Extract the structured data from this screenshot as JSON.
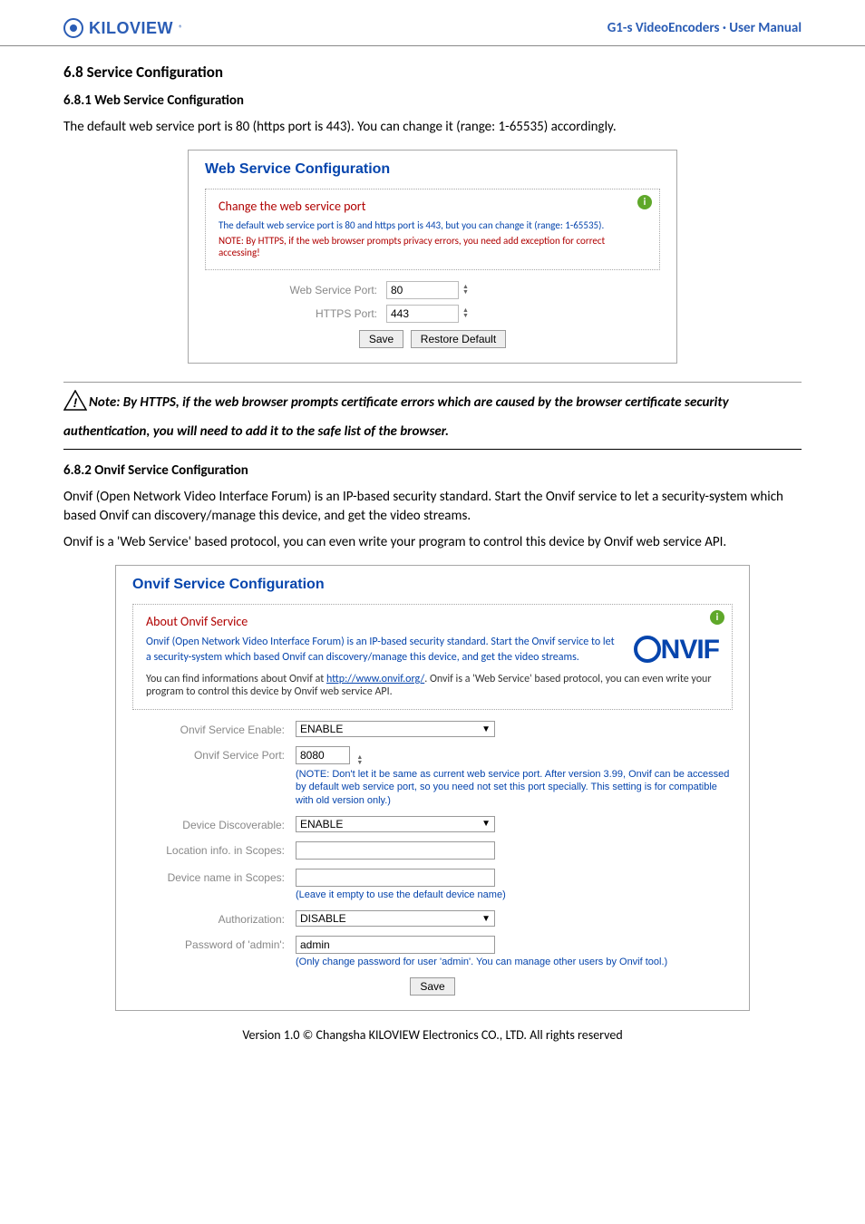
{
  "header": {
    "logo_text": "KILOVIEW",
    "manual_title": "G1-s VideoEncoders · User Manual"
  },
  "section": {
    "heading": "6.8 Service Configuration",
    "sub1": {
      "heading": "6.8.1   Web Service Configuration",
      "intro": "The default web service port is 80 (https port is 443). You can change it (range: 1-65535) accordingly."
    },
    "sub2": {
      "heading": "6.8.2   Onvif Service Configuration",
      "intro1": "Onvif (Open Network Video Interface Forum) is an IP-based security standard. Start the Onvif service to let a security-system which based Onvif can discovery/manage this device, and get the video streams.",
      "intro2": "Onvif is a 'Web Service' based protocol, you can even write your program to control this device by Onvif web service API."
    }
  },
  "web_panel": {
    "title": "Web Service Configuration",
    "box_heading": "Change the web service port",
    "box_line1": "The default web service port is 80 and https port is 443, but you can change it (range: 1-65535).",
    "box_line2": "NOTE: By HTTPS, if the web browser prompts privacy errors, you need add exception for correct accessing!",
    "rows": {
      "web_label": "Web Service Port:",
      "web_value": "80",
      "https_label": "HTTPS Port:",
      "https_value": "443"
    },
    "buttons": {
      "save": "Save",
      "restore": "Restore Default"
    }
  },
  "note": "Note: By HTTPS, if the web browser prompts certificate errors which are caused by the browser certificate security authentication, you will need to add it to the safe list of the browser.",
  "onvif_panel": {
    "title": "Onvif Service Configuration",
    "about_heading": "About Onvif Service",
    "about_para1": "Onvif (Open Network Video Interface Forum) is an IP-based security standard. Start the Onvif service to let a security-system which based Onvif can discovery/manage this device, and get the video streams.",
    "about_para2_pre": "You can find informations about Onvif at ",
    "about_para2_link": "http://www.onvif.org/",
    "about_para2_post": ". Onvif is a 'Web Service' based protocol, you can even write your program to control this device by Onvif web service API.",
    "onvif_logo": "NVIF",
    "fields": {
      "enable_label": "Onvif Service Enable:",
      "enable_value": "ENABLE",
      "port_label": "Onvif Service Port:",
      "port_value": "8080",
      "port_note": "(NOTE: Don't let it be same as current web service port. After version 3.99, Onvif can be accessed by default web service port, so you need not set this port specially. This setting is for compatible with old version only.)",
      "discover_label": "Device Discoverable:",
      "discover_value": "ENABLE",
      "loc_label": "Location info. in Scopes:",
      "loc_value": "",
      "devname_label": "Device name in Scopes:",
      "devname_value": "",
      "devname_note": "(Leave it empty to use the default device name)",
      "auth_label": "Authorization:",
      "auth_value": "DISABLE",
      "pwd_label": "Password of 'admin':",
      "pwd_value": "admin",
      "pwd_note": "(Only change password for user 'admin'. You can manage other users by Onvif tool.)"
    },
    "save": "Save"
  },
  "footer": "Version 1.0 © Changsha KILOVIEW Electronics CO., LTD. All rights reserved"
}
